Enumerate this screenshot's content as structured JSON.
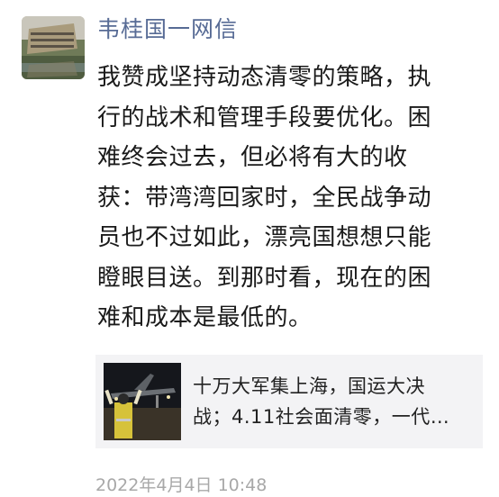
{
  "post": {
    "username": "韦桂国一网信",
    "avatar_icon": "building-photo",
    "body_lines": [
      "我赞成坚持动态清零的策略，执",
      "行的战术和管理手段要优化。困",
      "难终会过去，但必将有大的收",
      "获：带湾湾回家时，全民战争动",
      "员也不过如此，漂亮国想想只能",
      "瞪眼目送。到那时看，现在的困",
      "难和成本是最低的。"
    ],
    "link_card": {
      "thumbnail_icon": "airplane-runway-photo",
      "title_lines": [
        "十万大军集上海，国运大决",
        "战；4.11社会面清零，一代…"
      ]
    },
    "timestamp": "2022年4月4日 10:48"
  },
  "colors": {
    "name": "#576b95",
    "card_bg": "#f3f3f5",
    "timestamp": "#a8a8a8"
  }
}
